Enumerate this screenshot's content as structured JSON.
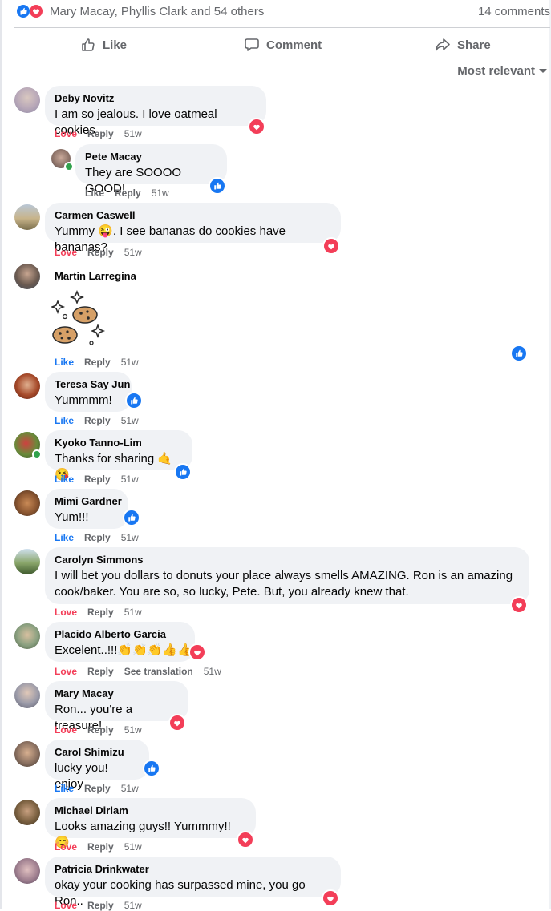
{
  "summary": {
    "reactors": "Mary Macay, Phyllis Clark and 54 others",
    "comments_count": "14 comments"
  },
  "actions": {
    "like": "Like",
    "comment": "Comment",
    "share": "Share"
  },
  "sort": {
    "label": "Most relevant"
  },
  "labels": {
    "love": "Love",
    "like": "Like",
    "reply": "Reply",
    "see_translation": "See translation",
    "time": "51w"
  },
  "comments": [
    {
      "author": "Deby Novitz",
      "text": "I am so jealous. I love oatmeal cookies",
      "reaction": "Love",
      "badge": "love"
    },
    {
      "author": "Pete Macay",
      "text": "They are SOOOO GOOD!",
      "reaction": "Like",
      "badge": "like"
    },
    {
      "author": "Carmen Caswell",
      "text": "Yummy 😜. I see bananas do cookies have bananas?",
      "reaction": "Love",
      "badge": "love"
    },
    {
      "author": "Martin Larregina",
      "text": "",
      "reaction": "Like",
      "badge": "like"
    },
    {
      "author": "Teresa Say Jun",
      "text": "Yummmm!",
      "reaction": "Like",
      "badge": "like"
    },
    {
      "author": "Kyoko Tanno-Lim",
      "text": "Thanks for sharing 🤙😘",
      "reaction": "Like",
      "badge": "like"
    },
    {
      "author": "Mimi Gardner",
      "text": "Yum!!!",
      "reaction": "Like",
      "badge": "like"
    },
    {
      "author": "Carolyn Simmons",
      "text": "I will bet you dollars to donuts your place always smells AMAZING. Ron is an amazing cook/baker. You are so, so lucky, Pete. But, you already knew that.",
      "reaction": "Love",
      "badge": "love"
    },
    {
      "author": "Placido Alberto Garcia",
      "text": "Excelent..!!!👏👏👏👍👍",
      "reaction": "Love",
      "badge": "love"
    },
    {
      "author": "Mary Macay",
      "text": "Ron... you're a treasure!",
      "reaction": "Love",
      "badge": "love"
    },
    {
      "author": "Carol Shimizu",
      "text": "lucky you! enjoy",
      "reaction": "Like",
      "badge": "like"
    },
    {
      "author": "Michael Dirlam",
      "text": "Looks amazing guys!! Yummmy!! 😊",
      "reaction": "Love",
      "badge": "love"
    },
    {
      "author": "Patricia Drinkwater",
      "text": "okay your cooking has surpassed mine, you go Ron..",
      "reaction": "Love",
      "badge": "love"
    }
  ]
}
